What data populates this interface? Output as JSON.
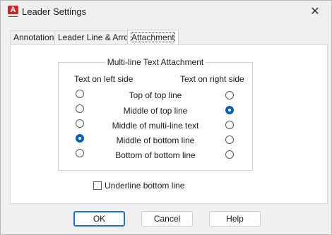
{
  "window": {
    "title": "Leader Settings",
    "close_glyph": "✕",
    "app_icon": "autocad-icon",
    "app_icon_letter": "A"
  },
  "tabs": [
    {
      "label": "Annotation"
    },
    {
      "label": "Leader Line & Arrow"
    },
    {
      "label": "Attachment"
    }
  ],
  "active_tab": "Attachment",
  "attachment": {
    "group_title": "Multi-line Text Attachment",
    "left_header": "Text on left side",
    "right_header": "Text on right side",
    "options": [
      {
        "label": "Top of top line",
        "left_selected": false,
        "right_selected": false
      },
      {
        "label": "Middle of top line",
        "left_selected": false,
        "right_selected": true
      },
      {
        "label": "Middle of multi-line text",
        "left_selected": false,
        "right_selected": false
      },
      {
        "label": "Middle of bottom line",
        "left_selected": true,
        "right_selected": false
      },
      {
        "label": "Bottom of bottom line",
        "left_selected": false,
        "right_selected": false
      }
    ],
    "underline_label": "Underline bottom line",
    "underline_checked": false
  },
  "buttons": {
    "ok": "OK",
    "cancel": "Cancel",
    "help": "Help"
  },
  "colors": {
    "accent": "#0060c0",
    "app_icon": "#d3262b"
  }
}
